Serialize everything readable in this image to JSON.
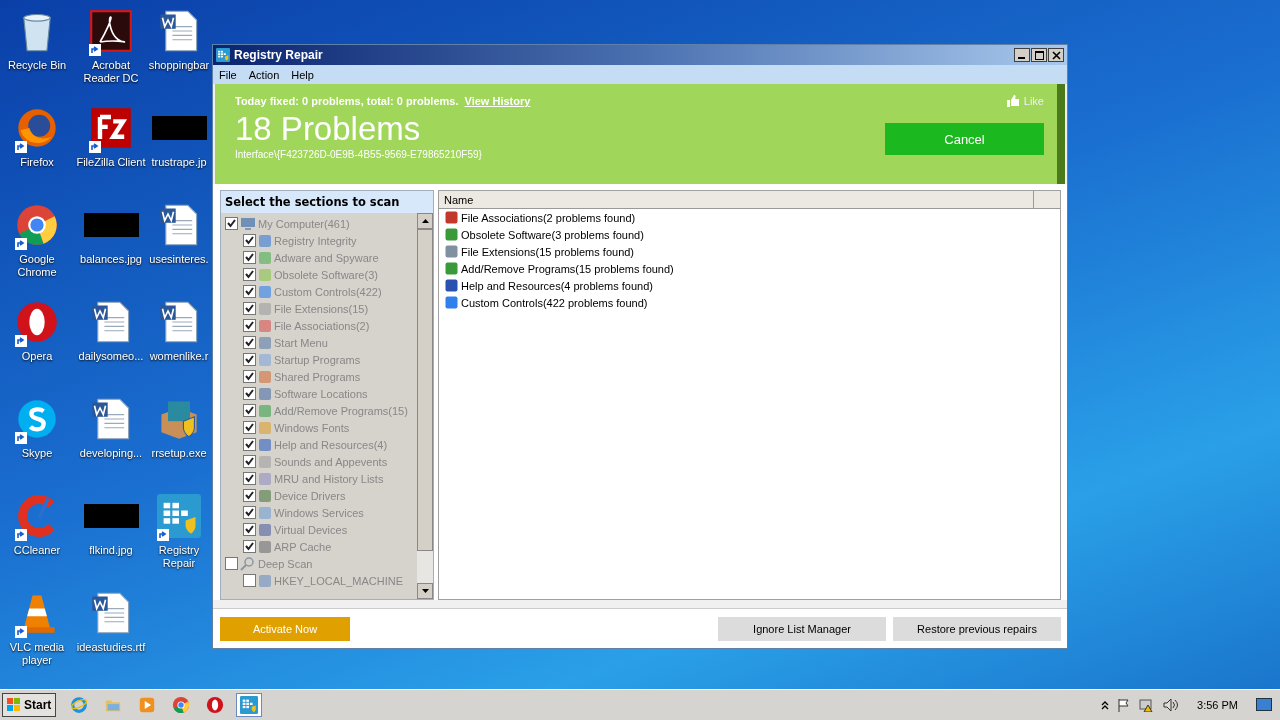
{
  "desktop": {
    "icons": [
      {
        "label": "Recycle Bin",
        "kind": "recycle",
        "shortcut": false
      },
      {
        "label": "Firefox",
        "kind": "firefox",
        "shortcut": true
      },
      {
        "label": "Google Chrome",
        "kind": "chrome",
        "shortcut": true
      },
      {
        "label": "Opera",
        "kind": "opera",
        "shortcut": true
      },
      {
        "label": "Skype",
        "kind": "skype",
        "shortcut": true
      },
      {
        "label": "CCleaner",
        "kind": "ccleaner",
        "shortcut": true
      },
      {
        "label": "VLC media player",
        "kind": "vlc",
        "shortcut": true
      },
      {
        "label": "Acrobat Reader DC",
        "kind": "pdf",
        "shortcut": true
      },
      {
        "label": "FileZilla Client",
        "kind": "filezilla",
        "shortcut": true
      },
      {
        "label": "balances.jpg",
        "kind": "image",
        "shortcut": false
      },
      {
        "label": "dailysomeo...",
        "kind": "doc",
        "shortcut": false
      },
      {
        "label": "developing...",
        "kind": "doc",
        "shortcut": false
      },
      {
        "label": "flkind.jpg",
        "kind": "image",
        "shortcut": false
      },
      {
        "label": "ideastudies.rtf",
        "kind": "doc",
        "shortcut": false
      },
      {
        "label": "shoppingbar",
        "kind": "doc",
        "shortcut": false
      },
      {
        "label": "trustrape.jp",
        "kind": "image",
        "shortcut": false
      },
      {
        "label": "usesinteres.",
        "kind": "doc",
        "shortcut": false
      },
      {
        "label": "womenlike.r",
        "kind": "doc",
        "shortcut": false
      },
      {
        "label": "rrsetup.exe",
        "kind": "setup",
        "shortcut": false
      },
      {
        "label": "Registry Repair",
        "kind": "registry",
        "shortcut": true
      }
    ]
  },
  "window": {
    "title": "Registry Repair",
    "menu": [
      "File",
      "Action",
      "Help"
    ],
    "banner": {
      "summary": "Today fixed: 0 problems, total: 0 problems.",
      "link": "View History",
      "like": "Like",
      "headline": "18 Problems",
      "path": "Interface\\{F423726D-0E9B-4B55-9569-E79865210F59}",
      "cancel": "Cancel"
    },
    "sections": {
      "title": "Select the sections to scan",
      "disabled": true,
      "tree": [
        {
          "label": "My Computer(461)",
          "checked": true,
          "children": [
            {
              "label": "Registry Integrity",
              "checked": true
            },
            {
              "label": "Adware and Spyware",
              "checked": true
            },
            {
              "label": "Obsolete Software(3)",
              "checked": true
            },
            {
              "label": "Custom Controls(422)",
              "checked": true
            },
            {
              "label": "File Extensions(15)",
              "checked": true
            },
            {
              "label": "File Associations(2)",
              "checked": true
            },
            {
              "label": "Start Menu",
              "checked": true
            },
            {
              "label": "Startup Programs",
              "checked": true
            },
            {
              "label": "Shared Programs",
              "checked": true
            },
            {
              "label": "Software Locations",
              "checked": true
            },
            {
              "label": "Add/Remove Programs(15)",
              "checked": true
            },
            {
              "label": "Windows Fonts",
              "checked": true
            },
            {
              "label": "Help and Resources(4)",
              "checked": true
            },
            {
              "label": "Sounds and Appevents",
              "checked": true
            },
            {
              "label": "MRU and History Lists",
              "checked": true
            },
            {
              "label": "Device Drivers",
              "checked": true
            },
            {
              "label": "Windows Services",
              "checked": true
            },
            {
              "label": "Virtual Devices",
              "checked": true
            },
            {
              "label": "ARP Cache",
              "checked": true
            }
          ]
        },
        {
          "label": "Deep Scan",
          "checked": false,
          "children": [
            {
              "label": "HKEY_LOCAL_MACHINE",
              "checked": false
            }
          ]
        }
      ]
    },
    "results": {
      "columns": [
        "Name"
      ],
      "rows": [
        "File Associations(2 problems found)",
        "Obsolete Software(3 problems found)",
        "File Extensions(15 problems found)",
        "Add/Remove Programs(15 problems found)",
        "Help and Resources(4 problems found)",
        "Custom Controls(422 problems found)"
      ]
    },
    "buttons": {
      "activate": "Activate Now",
      "ignore": "Ignore List Manager",
      "restore": "Restore previous repairs"
    }
  },
  "taskbar": {
    "start": "Start",
    "apps": [
      {
        "kind": "ie",
        "selected": false
      },
      {
        "kind": "explorer",
        "selected": false
      },
      {
        "kind": "media",
        "selected": false
      },
      {
        "kind": "chrome",
        "selected": false
      },
      {
        "kind": "opera",
        "selected": false
      },
      {
        "kind": "registry",
        "selected": true
      }
    ],
    "clock": "3:56 PM"
  }
}
